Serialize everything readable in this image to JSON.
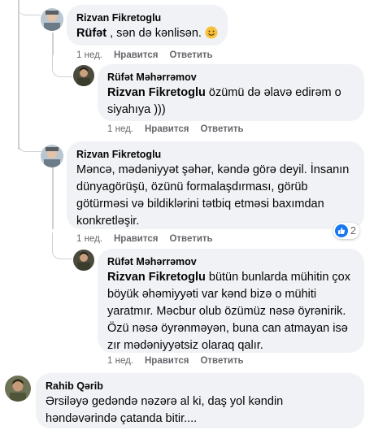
{
  "comments": [
    {
      "author": "Rizvan Fikretoglu",
      "mention": "Rüfət",
      "text": " , sən də kənlisən.",
      "emoji": "slightly-smiling-face",
      "time": "1 нед.",
      "like_label": "Нравится",
      "reply_label": "Ответить"
    },
    {
      "author": "Rüfət Məhərrəmov",
      "mention": "Rizvan Fikretoglu",
      "text": " özümü də əlavə edirəm o siyahıya )))",
      "time": "1 нед.",
      "like_label": "Нравится",
      "reply_label": "Ответить"
    },
    {
      "author": "Rizvan Fikretoglu",
      "text": "Məncə, mədəniyyət şəhər, kəndə görə deyil. İnsanın dünyagörüşü, özünü formalaşdırması, görüb götürməsi və bildiklərini tətbiq etməsi baxımdan konkretləşir.",
      "time": "1 нед.",
      "like_label": "Нравится",
      "reply_label": "Ответить",
      "reaction_icon": "like-icon",
      "reaction_count": "2"
    },
    {
      "author": "Rüfət Məhərrəmov",
      "mention": "Rizvan Fikretoglu",
      "text": " bütün bunlarda mühitin çox böyük əhəmiyyəti var kənd bizə o mühiti yaratmır. Məcbur olub özümüz nəsə öyrənirik. Özü nəsə öyrənməyən, buna can atmayan isə zır mədəniyyətsiz olaraq qalır.",
      "time": "1 нед.",
      "like_label": "Нравится",
      "reply_label": "Ответить"
    },
    {
      "author": "Rahib Qərib",
      "text": "Ərsiləyə gedəndə nəzərə al ki, daş yol kəndin həndəvərində çatanda bitir...."
    }
  ],
  "colors": {
    "bubble": "#f0f2f5",
    "meta": "#65676b",
    "like_blue": "#1877f2",
    "thread_line": "#ced0d4"
  }
}
